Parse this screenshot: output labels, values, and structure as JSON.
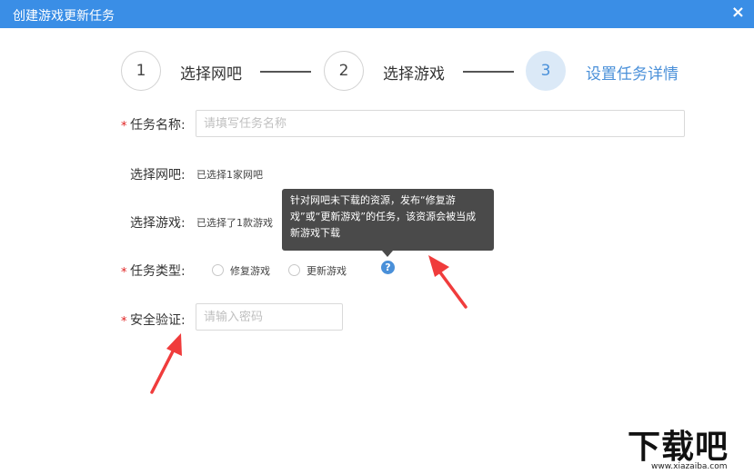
{
  "window": {
    "title": "创建游戏更新任务",
    "close_glyph": "×"
  },
  "steps": [
    {
      "number": "1",
      "label": "选择网吧"
    },
    {
      "number": "2",
      "label": "选择游戏"
    },
    {
      "number": "3",
      "label": "设置任务详情"
    }
  ],
  "form": {
    "required_mark": "*",
    "task_name": {
      "label": "任务名称:",
      "placeholder": "请填写任务名称",
      "value": ""
    },
    "select_netbar": {
      "label": "选择网吧:",
      "value": "已选择1家网吧"
    },
    "select_game": {
      "label": "选择游戏:",
      "value": "已选择了1款游戏"
    },
    "task_type": {
      "label": "任务类型:",
      "options": [
        "修复游戏",
        "更新游戏"
      ],
      "help_glyph": "?"
    },
    "security": {
      "label": "安全验证:",
      "placeholder": "请输入密码",
      "value": ""
    }
  },
  "tooltip": {
    "text": "针对网吧未下载的资源，发布“修复游戏”或“更新游戏”的任务，该资源会被当成新游戏下载"
  },
  "watermark": {
    "logo": "下载吧",
    "url": "www.xiazaiba.com"
  },
  "colors": {
    "accent": "#3a8ee6",
    "step_active": "#4a90d9",
    "required": "#e02020",
    "annotation_arrow": "#f03c3c"
  }
}
